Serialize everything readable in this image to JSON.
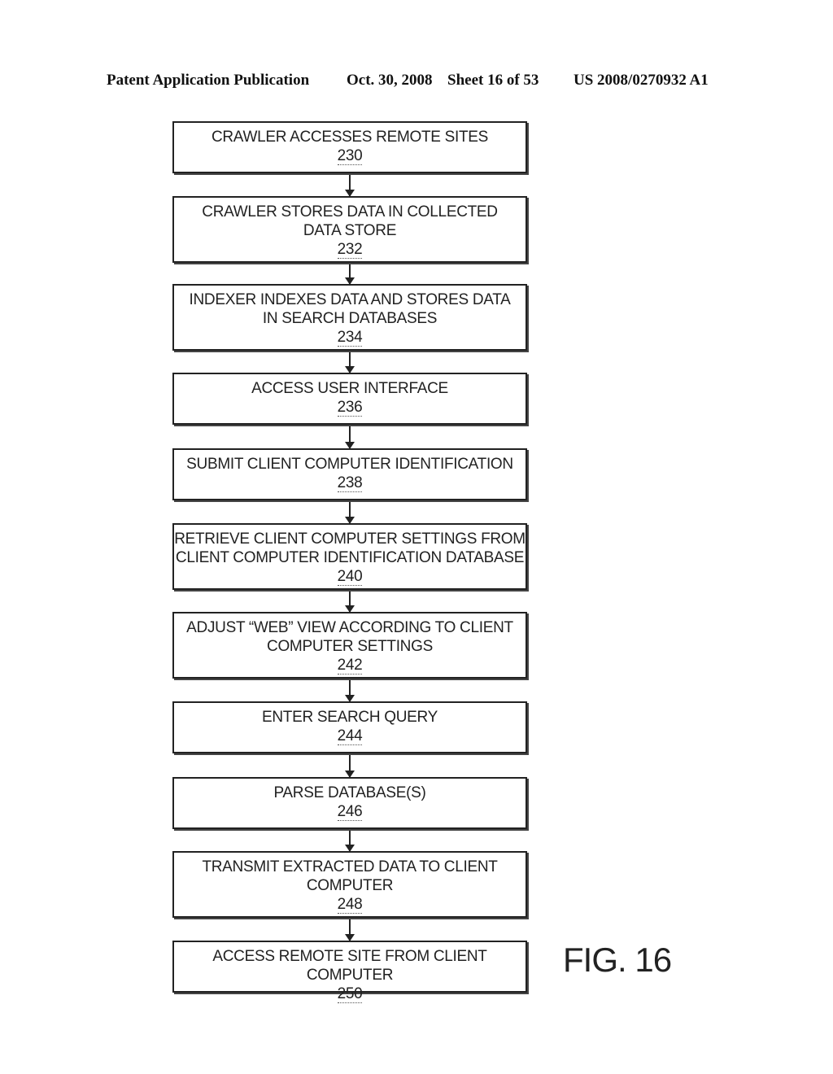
{
  "header": {
    "publication": "Patent Application Publication",
    "date": "Oct. 30, 2008",
    "sheet": "Sheet 16 of 53",
    "number": "US 2008/0270932 A1"
  },
  "figure_label": "FIG. 16",
  "steps": [
    {
      "lines": [
        "CRAWLER ACCESSES REMOTE SITES"
      ],
      "ref": "230"
    },
    {
      "lines": [
        "CRAWLER STORES DATA IN COLLECTED",
        "DATA STORE"
      ],
      "ref": "232"
    },
    {
      "lines": [
        "INDEXER INDEXES DATA AND STORES DATA",
        "IN SEARCH DATABASES"
      ],
      "ref": "234"
    },
    {
      "lines": [
        "ACCESS USER INTERFACE"
      ],
      "ref": "236"
    },
    {
      "lines": [
        "SUBMIT CLIENT COMPUTER IDENTIFICATION"
      ],
      "ref": "238"
    },
    {
      "lines": [
        "RETRIEVE CLIENT COMPUTER SETTINGS FROM",
        "CLIENT COMPUTER IDENTIFICATION DATABASE"
      ],
      "ref": "240"
    },
    {
      "lines": [
        "ADJUST “WEB” VIEW ACCORDING TO CLIENT",
        "COMPUTER SETTINGS"
      ],
      "ref": "242"
    },
    {
      "lines": [
        "ENTER SEARCH QUERY"
      ],
      "ref": "244"
    },
    {
      "lines": [
        "PARSE DATABASE(S)"
      ],
      "ref": "246"
    },
    {
      "lines": [
        "TRANSMIT EXTRACTED DATA TO CLIENT",
        "COMPUTER"
      ],
      "ref": "248"
    },
    {
      "lines": [
        "ACCESS REMOTE SITE FROM CLIENT COMPUTER"
      ],
      "ref": "250"
    }
  ]
}
